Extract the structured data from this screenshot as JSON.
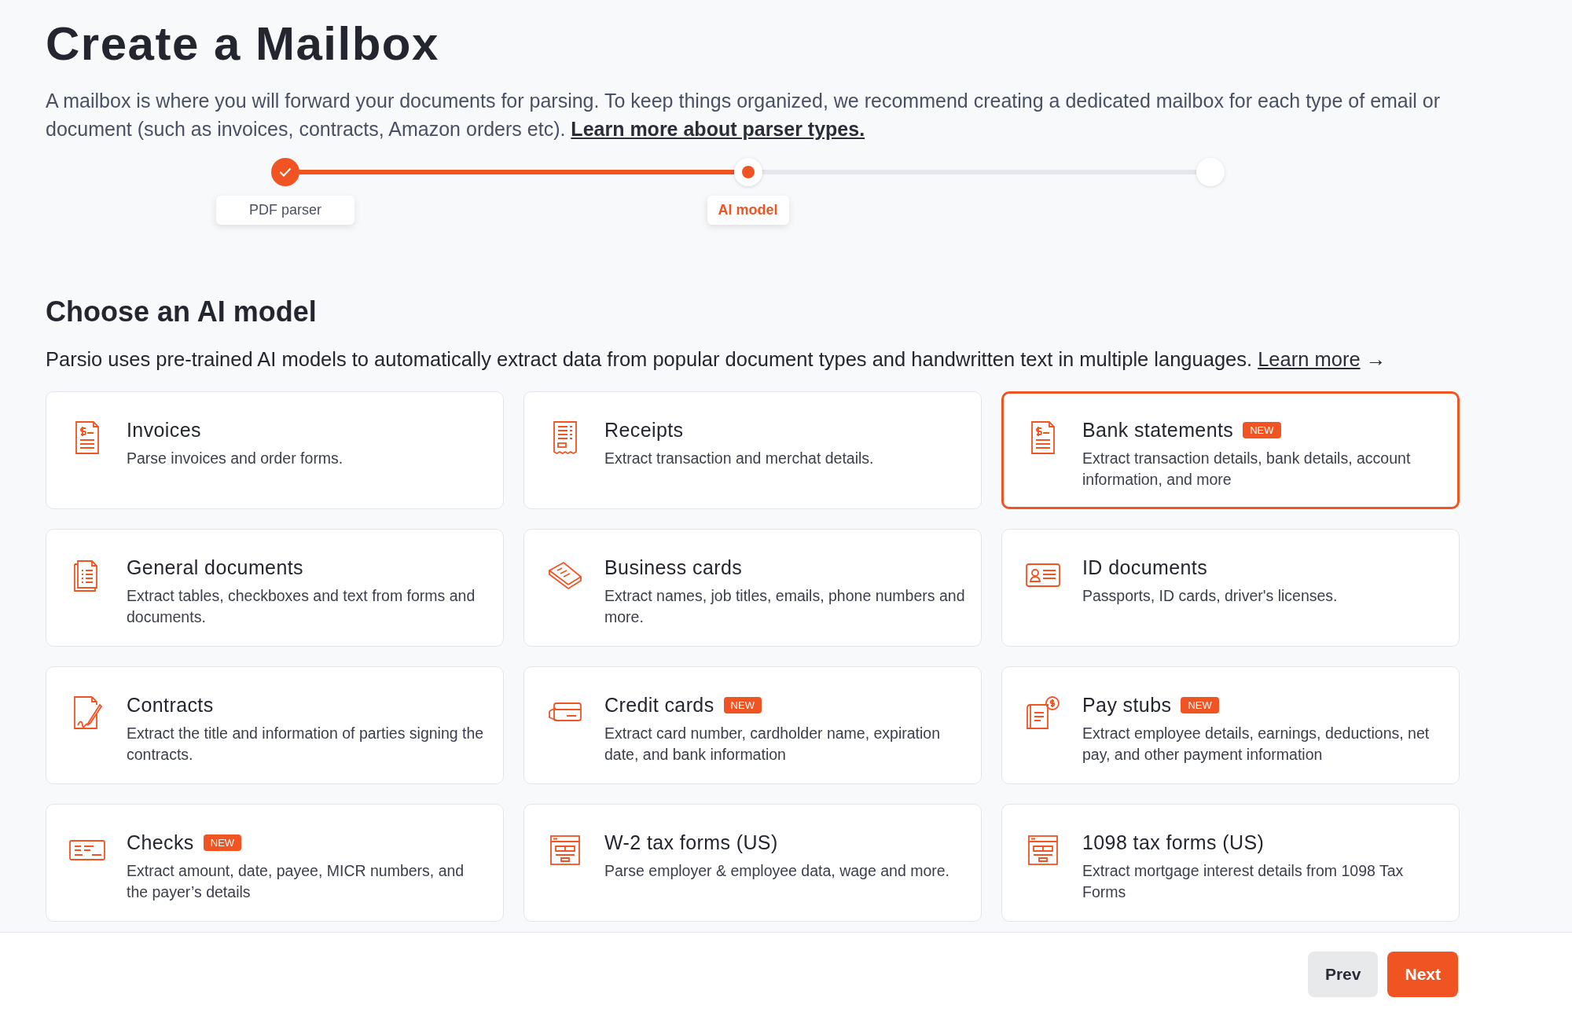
{
  "title": "Create a Mailbox",
  "intro": {
    "text": "A mailbox is where you will forward your documents for parsing. To keep things organized, we recommend creating a dedicated mailbox for each type of email or document (such as invoices, contracts, Amazon orders etc).",
    "link": "Learn more about parser types."
  },
  "stepper": {
    "level": 0.5,
    "steps": [
      {
        "label": "PDF parser",
        "kind": "done"
      },
      {
        "label": "AI model",
        "kind": "current"
      },
      {
        "kind": "pending"
      }
    ]
  },
  "section": {
    "title": "Choose an AI model",
    "text": "Parsio uses pre-trained AI models to automatically extract data from popular document types and handwritten text in multiple languages.",
    "link": "Learn more",
    "arrow": "→"
  },
  "models": [
    {
      "kind": "invoice",
      "title": "Invoices",
      "description": "Parse invoices and order forms.",
      "selected": false
    },
    {
      "kind": "receipt",
      "title": "Receipts",
      "description": "Extract transaction and merchat details.",
      "selected": false
    },
    {
      "kind": "bank",
      "title": "Bank statements",
      "badge": "NEW",
      "description": "Extract transaction details, bank details, account information, and more",
      "selected": true
    },
    {
      "kind": "document",
      "title": "General documents",
      "description": "Extract tables, checkboxes and text from forms and documents.",
      "selected": false
    },
    {
      "kind": "cards",
      "title": "Business cards",
      "description": "Extract names, job titles, emails, phone numbers and more.",
      "selected": false
    },
    {
      "kind": "id",
      "title": "ID documents",
      "description": "Passports, ID cards, driver's licenses.",
      "selected": false
    },
    {
      "kind": "contract",
      "title": "Contracts",
      "description": "Extract the title and information of parties signing the contracts.",
      "selected": false
    },
    {
      "kind": "creditcard",
      "title": "Credit cards",
      "badge": "NEW",
      "description": "Extract card number, cardholder name, expiration date, and bank information",
      "selected": false
    },
    {
      "kind": "paystub",
      "title": "Pay stubs",
      "badge": "NEW",
      "description": "Extract employee details, earnings, deductions, net pay, and other payment information",
      "selected": false
    },
    {
      "kind": "check",
      "title": "Checks",
      "badge": "NEW",
      "description": "Extract amount, date, payee, MICR numbers, and the payer’s details",
      "selected": false
    },
    {
      "kind": "form",
      "title": "W-2 tax forms (US)",
      "description": "Parse employer & employee data, wage and more.",
      "selected": false
    },
    {
      "kind": "form",
      "title": "1098 tax forms (US)",
      "description": "Extract mortgage interest details from 1098 Tax Forms",
      "selected": false
    }
  ],
  "buttons": [
    {
      "label": "Prev",
      "kind": "secondary"
    },
    {
      "label": "Next",
      "kind": "primary"
    }
  ]
}
